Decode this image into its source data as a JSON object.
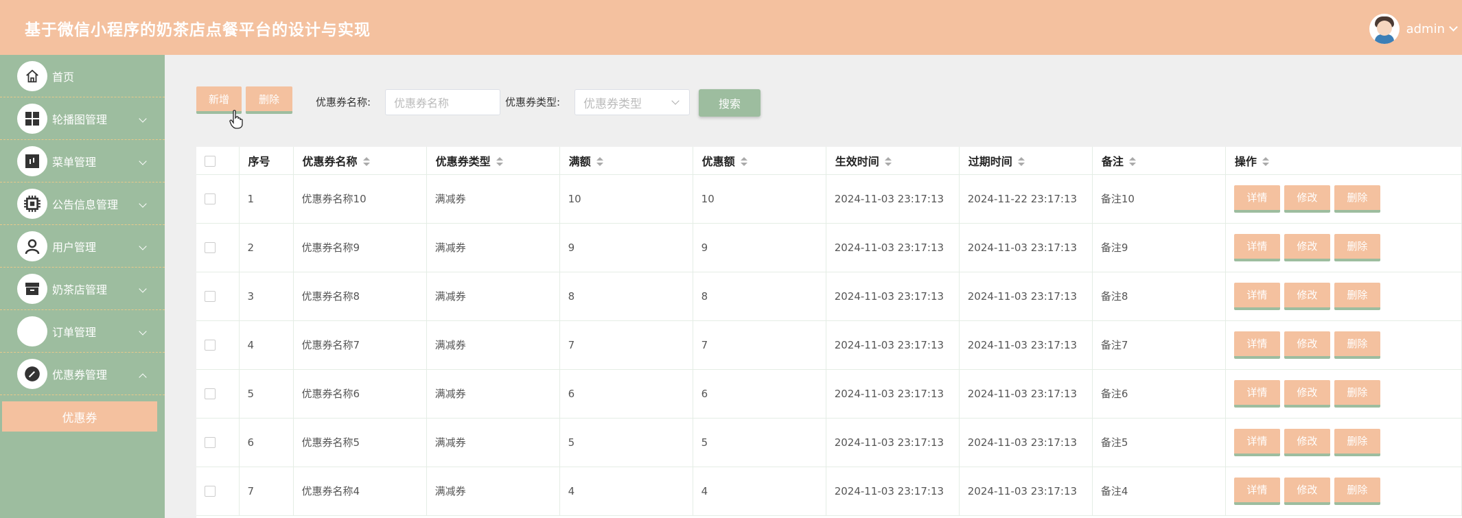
{
  "header": {
    "title": "基于微信小程序的奶茶店点餐平台的设计与实现",
    "username": "admin"
  },
  "sidebar": {
    "items": [
      {
        "label": "首页",
        "icon": "home-icon"
      },
      {
        "label": "轮播图管理",
        "icon": "grid-icon"
      },
      {
        "label": "菜单管理",
        "icon": "menu-icon"
      },
      {
        "label": "公告信息管理",
        "icon": "chip-icon"
      },
      {
        "label": "用户管理",
        "icon": "user-icon"
      },
      {
        "label": "奶茶店管理",
        "icon": "store-icon"
      },
      {
        "label": "订单管理",
        "icon": "order-icon"
      },
      {
        "label": "优惠券管理",
        "icon": "coupon-icon"
      }
    ],
    "active_sub": "优惠券"
  },
  "toolbar": {
    "add_label": "新增",
    "delete_label": "删除",
    "name_label": "优惠券名称:",
    "name_placeholder": "优惠券名称",
    "type_label": "优惠券类型:",
    "type_placeholder": "优惠券类型",
    "search_label": "搜索"
  },
  "table": {
    "columns": [
      "序号",
      "优惠券名称",
      "优惠券类型",
      "满额",
      "优惠额",
      "生效时间",
      "过期时间",
      "备注",
      "操作"
    ],
    "row_actions": [
      "详情",
      "修改",
      "删除"
    ],
    "rows": [
      [
        "1",
        "优惠券名称10",
        "满减券",
        "10",
        "10",
        "2024-11-03 23:17:13",
        "2024-11-22 23:17:13",
        "备注10"
      ],
      [
        "2",
        "优惠券名称9",
        "满减券",
        "9",
        "9",
        "2024-11-03 23:17:13",
        "2024-11-03 23:17:13",
        "备注9"
      ],
      [
        "3",
        "优惠券名称8",
        "满减券",
        "8",
        "8",
        "2024-11-03 23:17:13",
        "2024-11-03 23:17:13",
        "备注8"
      ],
      [
        "4",
        "优惠券名称7",
        "满减券",
        "7",
        "7",
        "2024-11-03 23:17:13",
        "2024-11-03 23:17:13",
        "备注7"
      ],
      [
        "5",
        "优惠券名称6",
        "满减券",
        "6",
        "6",
        "2024-11-03 23:17:13",
        "2024-11-03 23:17:13",
        "备注6"
      ],
      [
        "6",
        "优惠券名称5",
        "满减券",
        "5",
        "5",
        "2024-11-03 23:17:13",
        "2024-11-03 23:17:13",
        "备注5"
      ],
      [
        "7",
        "优惠券名称4",
        "满减券",
        "4",
        "4",
        "2024-11-03 23:17:13",
        "2024-11-03 23:17:13",
        "备注4"
      ]
    ]
  },
  "colors": {
    "accent": "#f4c19f",
    "sidebar": "#9dbd9f",
    "background": "#efefef"
  }
}
